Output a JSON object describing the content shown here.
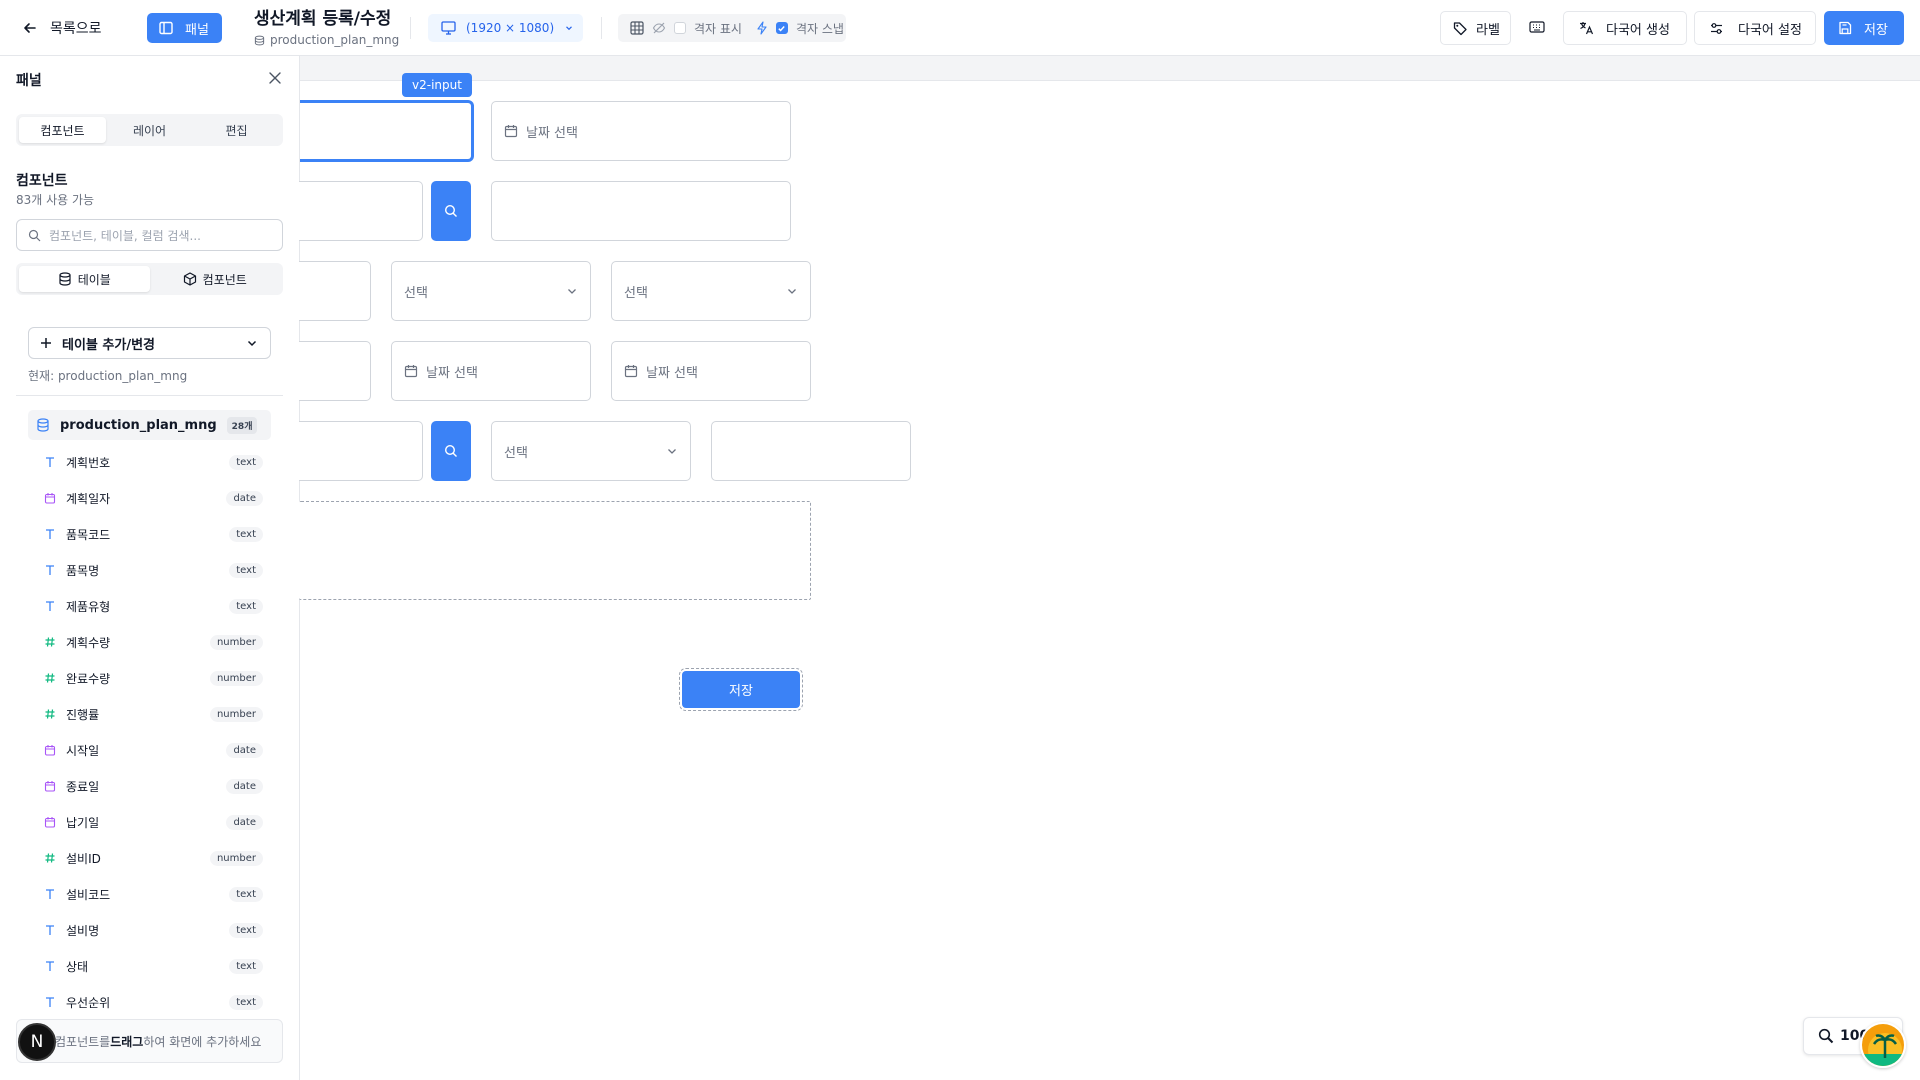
{
  "topbar": {
    "back_label": "목록으로",
    "panel_label": "패널",
    "title": "생산계획 등록/수정",
    "table_name": "production_plan_mng",
    "resolution": "(1920 × 1080)",
    "grid_show_label": "격자 표시",
    "grid_snap_label": "격자 스냅",
    "label_button": "라벨",
    "multilang_generate": "다국어 생성",
    "multilang_settings": "다국어 설정",
    "save": "저장"
  },
  "panel": {
    "title": "패널",
    "tabs": [
      "컴포넌트",
      "레이어",
      "편집"
    ],
    "section_title": "컴포넌트",
    "section_count": "83개 사용 가능",
    "search_placeholder": "컴포넌트, 테이블, 컬럼 검색...",
    "subtabs": [
      "테이블",
      "컴포넌트"
    ],
    "table_add_button": "테이블 추가/변경",
    "current_table": "현재: production_plan_mng",
    "table": {
      "name": "production_plan_mng",
      "count": "28개"
    },
    "columns": [
      {
        "name": "계획번호",
        "type": "text",
        "icon": "text-icon"
      },
      {
        "name": "계획일자",
        "type": "date",
        "icon": "calendar-icon"
      },
      {
        "name": "품목코드",
        "type": "text",
        "icon": "text-icon"
      },
      {
        "name": "품목명",
        "type": "text",
        "icon": "text-icon"
      },
      {
        "name": "제품유형",
        "type": "text",
        "icon": "text-icon"
      },
      {
        "name": "계획수량",
        "type": "number",
        "icon": "hash-icon"
      },
      {
        "name": "완료수량",
        "type": "number",
        "icon": "hash-icon"
      },
      {
        "name": "진행률",
        "type": "number",
        "icon": "hash-icon"
      },
      {
        "name": "시작일",
        "type": "date",
        "icon": "calendar-icon"
      },
      {
        "name": "종료일",
        "type": "date",
        "icon": "calendar-icon"
      },
      {
        "name": "납기일",
        "type": "date",
        "icon": "calendar-icon"
      },
      {
        "name": "설비ID",
        "type": "number",
        "icon": "hash-icon"
      },
      {
        "name": "설비코드",
        "type": "text",
        "icon": "text-icon"
      },
      {
        "name": "설비명",
        "type": "text",
        "icon": "text-icon"
      },
      {
        "name": "상태",
        "type": "text",
        "icon": "text-icon"
      },
      {
        "name": "우선순위",
        "type": "text",
        "icon": "text-icon"
      }
    ],
    "hint_pre": "컴포넌트를 ",
    "hint_bold": "드래그",
    "hint_post": "하여 화면에 추가하세요",
    "n_badge": "N"
  },
  "canvas": {
    "selected_label": "v2-input",
    "date_placeholder": "날짜 선택",
    "select_placeholder": "선택",
    "save_button": "저장",
    "zoom": "100"
  },
  "colors": {
    "accent": "#3b82f6",
    "text_icon": "#3b82f6",
    "date_icon": "#a855f7",
    "number_icon": "#10b981"
  }
}
